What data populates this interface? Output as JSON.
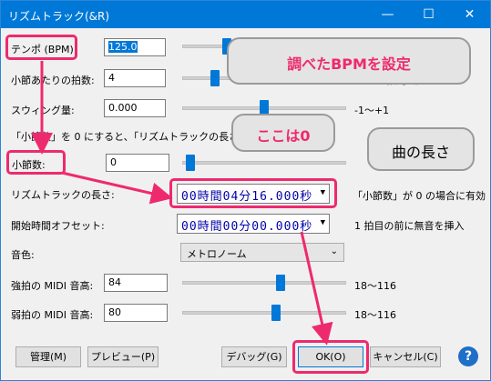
{
  "window": {
    "title": "リズムトラック(&R)",
    "minimize": "—",
    "maximize": "☐",
    "close": "✕"
  },
  "fields": {
    "tempo_label": "テンポ (BPM):",
    "tempo_value": "125.0",
    "beats_label": "小節あたりの拍数:",
    "beats_value": "4",
    "beats_range": "1～20 拍/小節",
    "swing_label": "スウィング量:",
    "swing_value": "0.000",
    "swing_range": "-1～+1",
    "note_prefix": "「小節数」を 0 にすると、「リズムトラックの長さ」が使われます",
    "bars_label": "小節数:",
    "bars_value": "0",
    "length_label": "リズムトラックの長さ:",
    "length_value": "00時間04分16.000秒",
    "length_note": "「小節数」が 0 の場合に有効",
    "offset_label": "開始時間オフセット:",
    "offset_value": "00時間00分00.000秒",
    "offset_note": "1 拍目の前に無音を挿入",
    "sound_label": "音色:",
    "sound_value": "メトロノーム",
    "strong_label": "強拍の MIDI 音高:",
    "strong_value": "84",
    "strong_range": "18～116",
    "weak_label": "弱拍の MIDI 音高:",
    "weak_value": "80",
    "weak_range": "18～116"
  },
  "sliders": {
    "tempo": 0.27,
    "beats": 0.2,
    "swing": 0.5,
    "bars": 0.05,
    "strong": 0.6,
    "weak": 0.57
  },
  "buttons": {
    "manage": "管理(M)",
    "preview": "プレビュー(P)",
    "debug": "デバッグ(G)",
    "ok": "OK(O)",
    "cancel": "キャンセル(C)",
    "help": "?"
  },
  "annotations": {
    "callout_bpm": "調べたBPMを設定",
    "callout_zero": "ここは0",
    "callout_length": "曲の長さ"
  },
  "colors": {
    "highlight": "#ee2a6e",
    "arrow": "#ee2a6e",
    "accent": "#0078d7"
  }
}
